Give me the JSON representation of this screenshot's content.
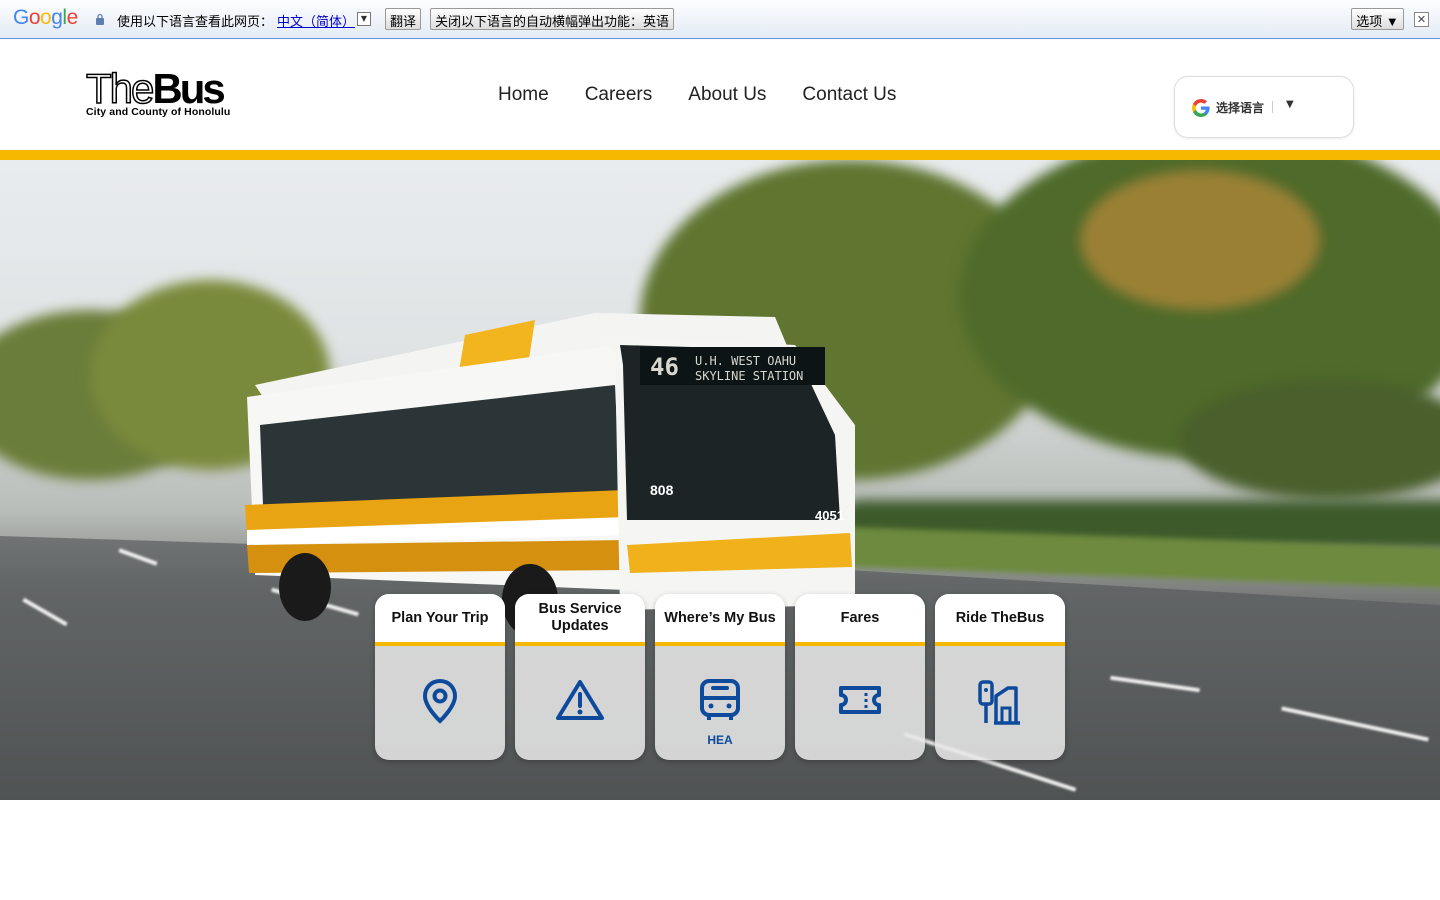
{
  "translate_bar": {
    "logo": "Google",
    "prompt": "使用以下语言查看此网页：",
    "language": "中文（简体）",
    "translate_button": "翻译",
    "never_button": "关闭以下语言的自动横幅弹出功能：英语",
    "options_button": "选项 ▼",
    "close_glyph": "✕"
  },
  "header": {
    "logo_main_the": "The",
    "logo_main_bus": "Bus",
    "logo_sub": "City and County of Honolulu",
    "nav": [
      "Home",
      "Careers",
      "About Us",
      "Contact Us"
    ],
    "language_select": {
      "label": "选择语言",
      "arrow": "▼"
    }
  },
  "hero": {
    "bus_sign_number": "46",
    "bus_sign_line1": "U.H. WEST OAHU",
    "bus_sign_line2": "SKYLINE STATION",
    "bus_number": "4051",
    "bus_plate": "808"
  },
  "cards": [
    {
      "title": "Plan Your Trip",
      "icon": "map-pin-icon",
      "note": ""
    },
    {
      "title": "Bus Service Updates",
      "icon": "warning-icon",
      "note": ""
    },
    {
      "title": "Where’s My Bus",
      "icon": "bus-icon",
      "note": "HEA"
    },
    {
      "title": "Fares",
      "icon": "ticket-icon",
      "note": ""
    },
    {
      "title": "Ride TheBus",
      "icon": "bus-stop-icon",
      "note": ""
    }
  ],
  "colors": {
    "accent_yellow": "#f6b800",
    "icon_blue": "#0d4a9c",
    "translate_link": "#0000cc"
  }
}
